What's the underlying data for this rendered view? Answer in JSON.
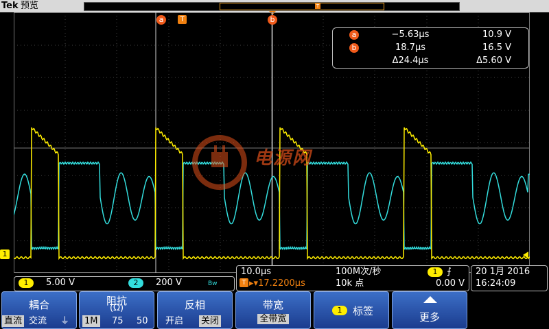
{
  "header": {
    "brand": "Tek",
    "mode": "预览",
    "memory_trigger_label": "T"
  },
  "cursors": {
    "a": {
      "label": "a",
      "time": "−5.63µs",
      "voltage": "10.9 V"
    },
    "b": {
      "label": "b",
      "time": "18.7µs",
      "voltage": "16.5 V"
    },
    "delta": {
      "time": "Δ24.4µs",
      "voltage": "Δ5.60 V"
    }
  },
  "trigger_marker_label": "T",
  "ch1_marker": "1",
  "watermark": {
    "text": "电源网"
  },
  "channels": {
    "ch1": {
      "badge": "1",
      "scale": "5.00 V",
      "color": "#ffee00"
    },
    "ch2": {
      "badge": "2",
      "scale": "200 V",
      "bw_label": "Bw",
      "color": "#33dddd"
    }
  },
  "horizontal": {
    "time_per_div": "10.0µs",
    "sample_rate": "100M次/秒",
    "trigger_position_label": "T",
    "trigger_position": "▸▾17.2200µs",
    "record_length": "10k 点",
    "trigger_source_badge": "1",
    "trigger_slope": "⨍",
    "trigger_level": "0.00 V"
  },
  "datetime": {
    "date": "20 1月 2016",
    "time": "16:24:09"
  },
  "softkeys": [
    {
      "label": "耦合",
      "options": [
        "直流",
        "交流",
        "⏚"
      ],
      "selected": 0
    },
    {
      "label": "阻抗",
      "sublabel": "(Ω)",
      "options": [
        "1M",
        "75",
        "50"
      ],
      "selected": 0
    },
    {
      "label": "反相",
      "options": [
        "开启",
        "关闭"
      ],
      "selected": 1
    },
    {
      "label": "带宽",
      "sublabel": "全带宽"
    },
    {
      "label": "标签",
      "badge": "1"
    },
    {
      "label": "更多"
    }
  ],
  "colors": {
    "ch1": "#ffee00",
    "ch2": "#33dddd",
    "cursor": "#f05a1a",
    "trigger": "#f08010",
    "softkey": "#2a56b5"
  }
}
